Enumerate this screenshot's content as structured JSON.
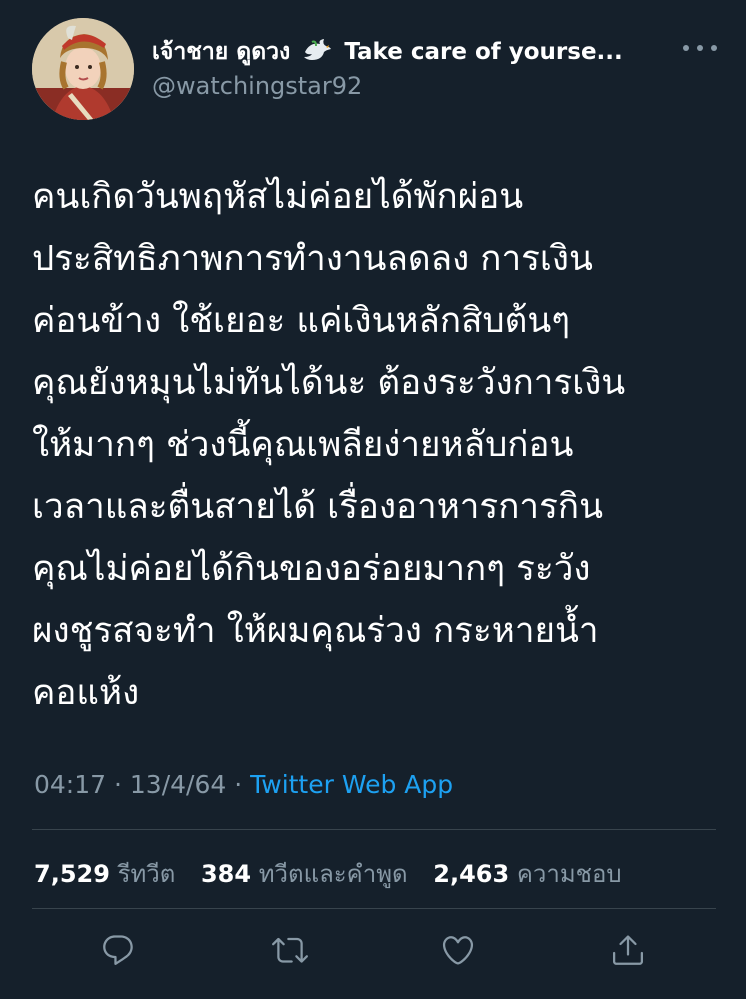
{
  "author": {
    "display_name": "เจ้าชาย ดูดวง",
    "name_suffix": "Take care of yourse...",
    "handle": "@watchingstar92",
    "avatar_icon": "profile-avatar-painting",
    "badge_icon": "dove-emoji"
  },
  "tweet": {
    "lines": [
      "คนเกิดวันพฤหัสไม่ค่อยได้พักผ่อน",
      "ประสิทธิภาพการทำงานลดลง การเงิน",
      "ค่อนข้าง ใช้เยอะ แค่เงินหลักสิบต้นๆ",
      "คุณยังหมุนไม่ทันได้นะ ต้องระวังการเงิน",
      " ให้มากๆ ช่วงนี้คุณเพลียง่ายหลับก่อน",
      "เวลาและตื่นสายได้ เรื่องอาหารการกิน",
      "คุณไม่ค่อยได้กินของอร่อยมากๆ ระวัง",
      "ผงชูรสจะทำ ให้ผมคุณร่วง กระหายน้ำ",
      "คอแห้ง"
    ],
    "time": "04:17",
    "separator": " · ",
    "date": "13/4/64",
    "source": "Twitter Web App"
  },
  "stats": {
    "retweets": {
      "count": "7,529",
      "label": "รีทวีต"
    },
    "quotes": {
      "count": "384",
      "label": "ทวีตและคำพูด"
    },
    "likes": {
      "count": "2,463",
      "label": "ความชอบ"
    }
  },
  "colors": {
    "background": "#15202b",
    "text": "#ffffff",
    "secondary": "#8899a6",
    "accent": "#1da1f2",
    "divider": "#38444d"
  },
  "actions": [
    {
      "icon": "reply-icon"
    },
    {
      "icon": "retweet-icon"
    },
    {
      "icon": "like-icon"
    },
    {
      "icon": "share-icon"
    }
  ]
}
